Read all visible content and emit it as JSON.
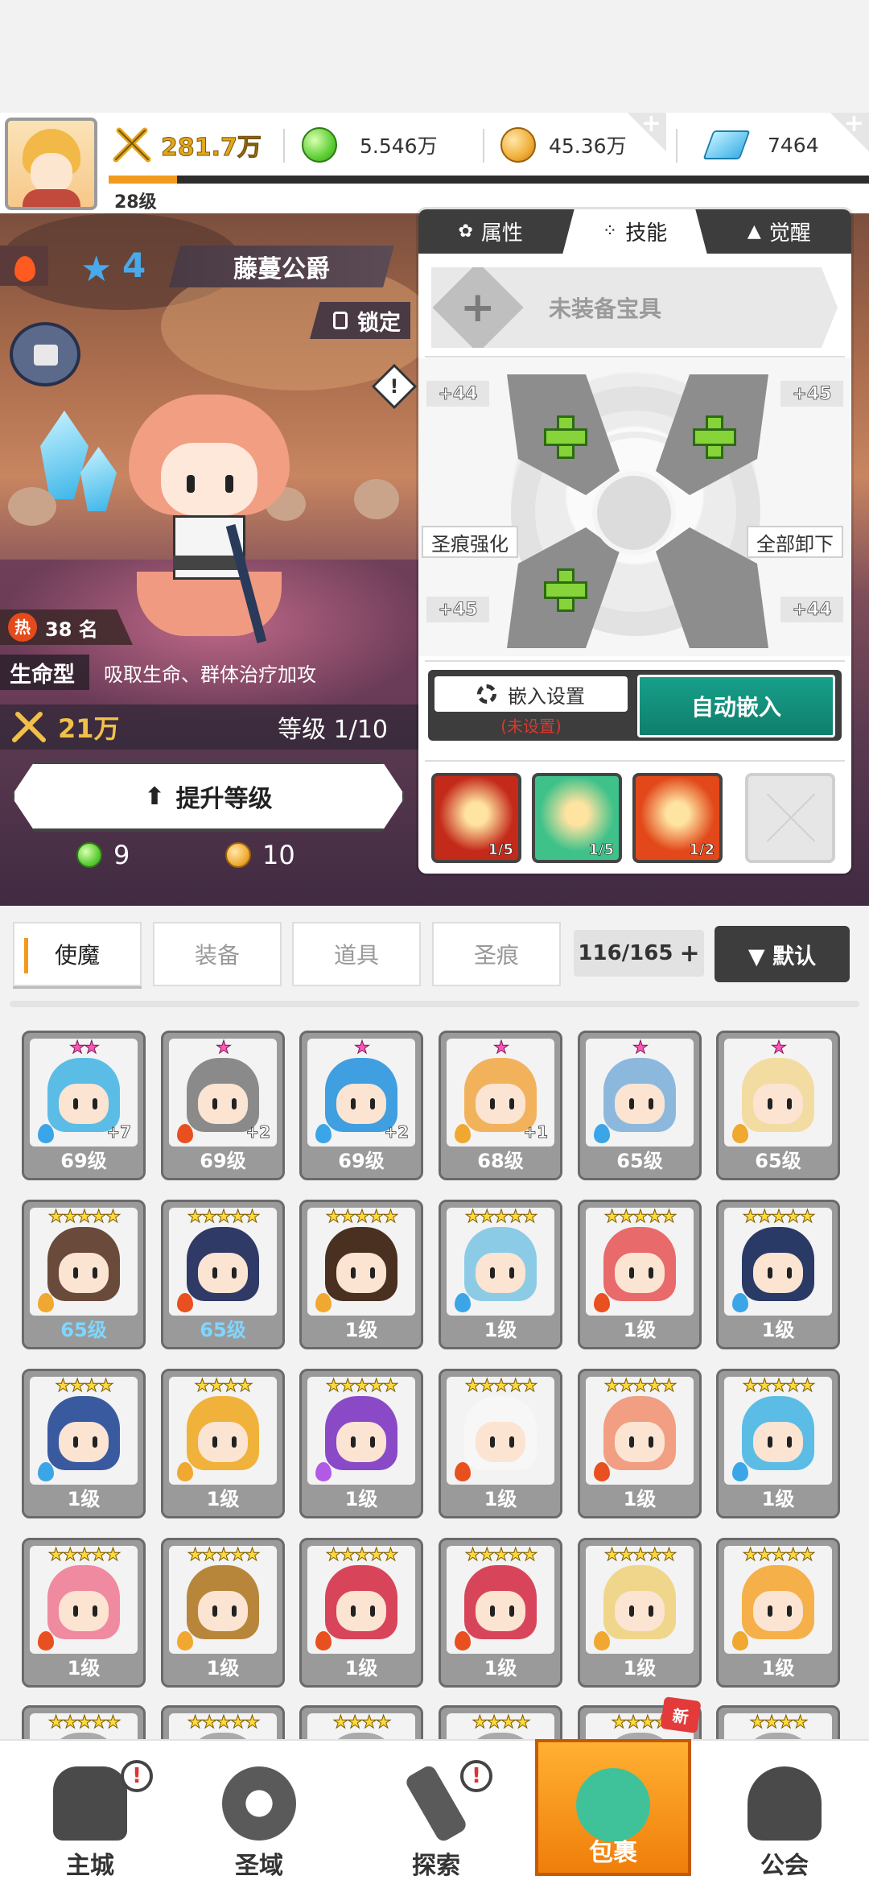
{
  "topbar": {
    "power": "281.7万",
    "green_gems": "5.546万",
    "coins": "45.36万",
    "diamonds": "7464",
    "player_level": "28级",
    "xp_fraction": 0.09
  },
  "hero": {
    "stars": "4",
    "name": "藤蔓公爵",
    "lock_label": "锁定",
    "warn_mark": "!",
    "rank_hot": "热",
    "rank": "38 名",
    "type": "生命型",
    "type_desc": "吸取生命、群体治疗加攻",
    "power": "21万",
    "level": "等级 1/10",
    "upgrade_label": "提升等级",
    "cost_gems": "9",
    "cost_coins": "10"
  },
  "panel": {
    "tabs": [
      "属性",
      "技能",
      "觉醒"
    ],
    "active_tab": "技能",
    "treasure_label": "未装备宝具",
    "treasure_plus": "+",
    "pct_tl": "+44",
    "pct_tr": "+45",
    "pct_bl": "+45",
    "pct_br": "+44",
    "left_btn": "圣痕强化",
    "right_btn": "全部卸下",
    "embed_setting": "嵌入设置",
    "embed_status": "(未设置)",
    "auto_embed": "自动嵌入",
    "runes": [
      {
        "count": "1/5",
        "color": "#c42a1a"
      },
      {
        "count": "1/5",
        "color": "#3fc28a"
      },
      {
        "count": "1/2",
        "color": "#e2481a"
      }
    ]
  },
  "inventory": {
    "tabs": [
      "使魔",
      "装备",
      "道具",
      "圣痕"
    ],
    "active_tab": "使魔",
    "count": "116/165",
    "count_plus": "+",
    "sort_label": "▼ 默认",
    "new_label": "新",
    "rows": [
      [
        {
          "stars": "★★",
          "pink": true,
          "level": "69级",
          "plus": "+7",
          "hair": "#5bbde6",
          "elem": "#3aa6e8"
        },
        {
          "stars": "★",
          "pink": true,
          "level": "69级",
          "plus": "+2",
          "hair": "#8a8a8a",
          "elem": "#e8501f"
        },
        {
          "stars": "★",
          "pink": true,
          "level": "69级",
          "plus": "+2",
          "hair": "#3f9fe0",
          "elem": "#3aa6e8"
        },
        {
          "stars": "★",
          "pink": true,
          "level": "68级",
          "plus": "+1",
          "hair": "#f2b25c",
          "elem": "#f0a830"
        },
        {
          "stars": "★",
          "pink": true,
          "level": "65级",
          "plus": "",
          "hair": "#8db8de",
          "elem": "#3aa6e8"
        },
        {
          "stars": "★",
          "pink": true,
          "level": "65级",
          "plus": "",
          "hair": "#f3dca2",
          "elem": "#f0a830"
        }
      ],
      [
        {
          "stars": "★★★★★",
          "pink": false,
          "level": "65级",
          "blue": true,
          "hair": "#6a4a3a",
          "elem": "#f0a830"
        },
        {
          "stars": "★★★★★",
          "pink": false,
          "level": "65级",
          "blue": true,
          "hair": "#2f3a66",
          "elem": "#e8501f"
        },
        {
          "stars": "★★★★★",
          "pink": false,
          "level": "1级",
          "hair": "#4a3020",
          "elem": "#f0a830"
        },
        {
          "stars": "★★★★★",
          "pink": false,
          "level": "1级",
          "hair": "#8ccbe6",
          "elem": "#3aa6e8"
        },
        {
          "stars": "★★★★★",
          "pink": false,
          "level": "1级",
          "hair": "#e86a6a",
          "elem": "#e8501f"
        },
        {
          "stars": "★★★★★",
          "pink": false,
          "level": "1级",
          "hair": "#2a3a66",
          "elem": "#3aa6e8"
        }
      ],
      [
        {
          "stars": "★★★★",
          "pink": false,
          "level": "1级",
          "hair": "#3a5aa0",
          "elem": "#3aa6e8"
        },
        {
          "stars": "★★★★",
          "pink": false,
          "level": "1级",
          "hair": "#f0b23a",
          "elem": "#f0a830"
        },
        {
          "stars": "★★★★★",
          "pink": false,
          "level": "1级",
          "hair": "#8a4ac8",
          "elem": "#b25ae6"
        },
        {
          "stars": "★★★★★",
          "pink": false,
          "level": "1级",
          "hair": "#f7f7f7",
          "elem": "#e8501f"
        },
        {
          "stars": "★★★★★",
          "pink": false,
          "level": "1级",
          "hair": "#f19e83",
          "elem": "#e8501f"
        },
        {
          "stars": "★★★★★",
          "pink": false,
          "level": "1级",
          "hair": "#5bbde6",
          "elem": "#3aa6e8"
        }
      ],
      [
        {
          "stars": "★★★★★",
          "pink": false,
          "level": "1级",
          "hair": "#f08aa0",
          "elem": "#e8501f"
        },
        {
          "stars": "★★★★★",
          "pink": false,
          "level": "1级",
          "hair": "#b8863a",
          "elem": "#f0a830"
        },
        {
          "stars": "★★★★★",
          "pink": false,
          "level": "1级",
          "hair": "#d8455a",
          "elem": "#e8501f"
        },
        {
          "stars": "★★★★★",
          "pink": false,
          "level": "1级",
          "hair": "#d8455a",
          "elem": "#e8501f"
        },
        {
          "stars": "★★★★★",
          "pink": false,
          "level": "1级",
          "hair": "#f0d68a",
          "elem": "#f0a830"
        },
        {
          "stars": "★★★★★",
          "pink": false,
          "level": "1级",
          "hair": "#f5b04a",
          "elem": "#f0a830"
        }
      ],
      [
        {
          "stars": "★★★★★",
          "pink": false,
          "level": "",
          "hair": "#aaa",
          "elem": ""
        },
        {
          "stars": "★★★★★",
          "pink": false,
          "level": "",
          "hair": "#aaa",
          "elem": ""
        },
        {
          "stars": "★★★★",
          "pink": false,
          "level": "",
          "hair": "#aaa",
          "elem": ""
        },
        {
          "stars": "★★★★",
          "pink": false,
          "level": "",
          "hair": "#aaa",
          "elem": ""
        },
        {
          "stars": "★★★★",
          "pink": false,
          "level": "",
          "hair": "#aaa",
          "elem": "",
          "new": true
        },
        {
          "stars": "★★★★",
          "pink": false,
          "level": "",
          "hair": "#aaa",
          "elem": ""
        }
      ]
    ]
  },
  "nav": {
    "items": [
      "主城",
      "圣域",
      "探索",
      "包裹",
      "公会"
    ],
    "active": "包裹",
    "alert_mark": "!"
  }
}
